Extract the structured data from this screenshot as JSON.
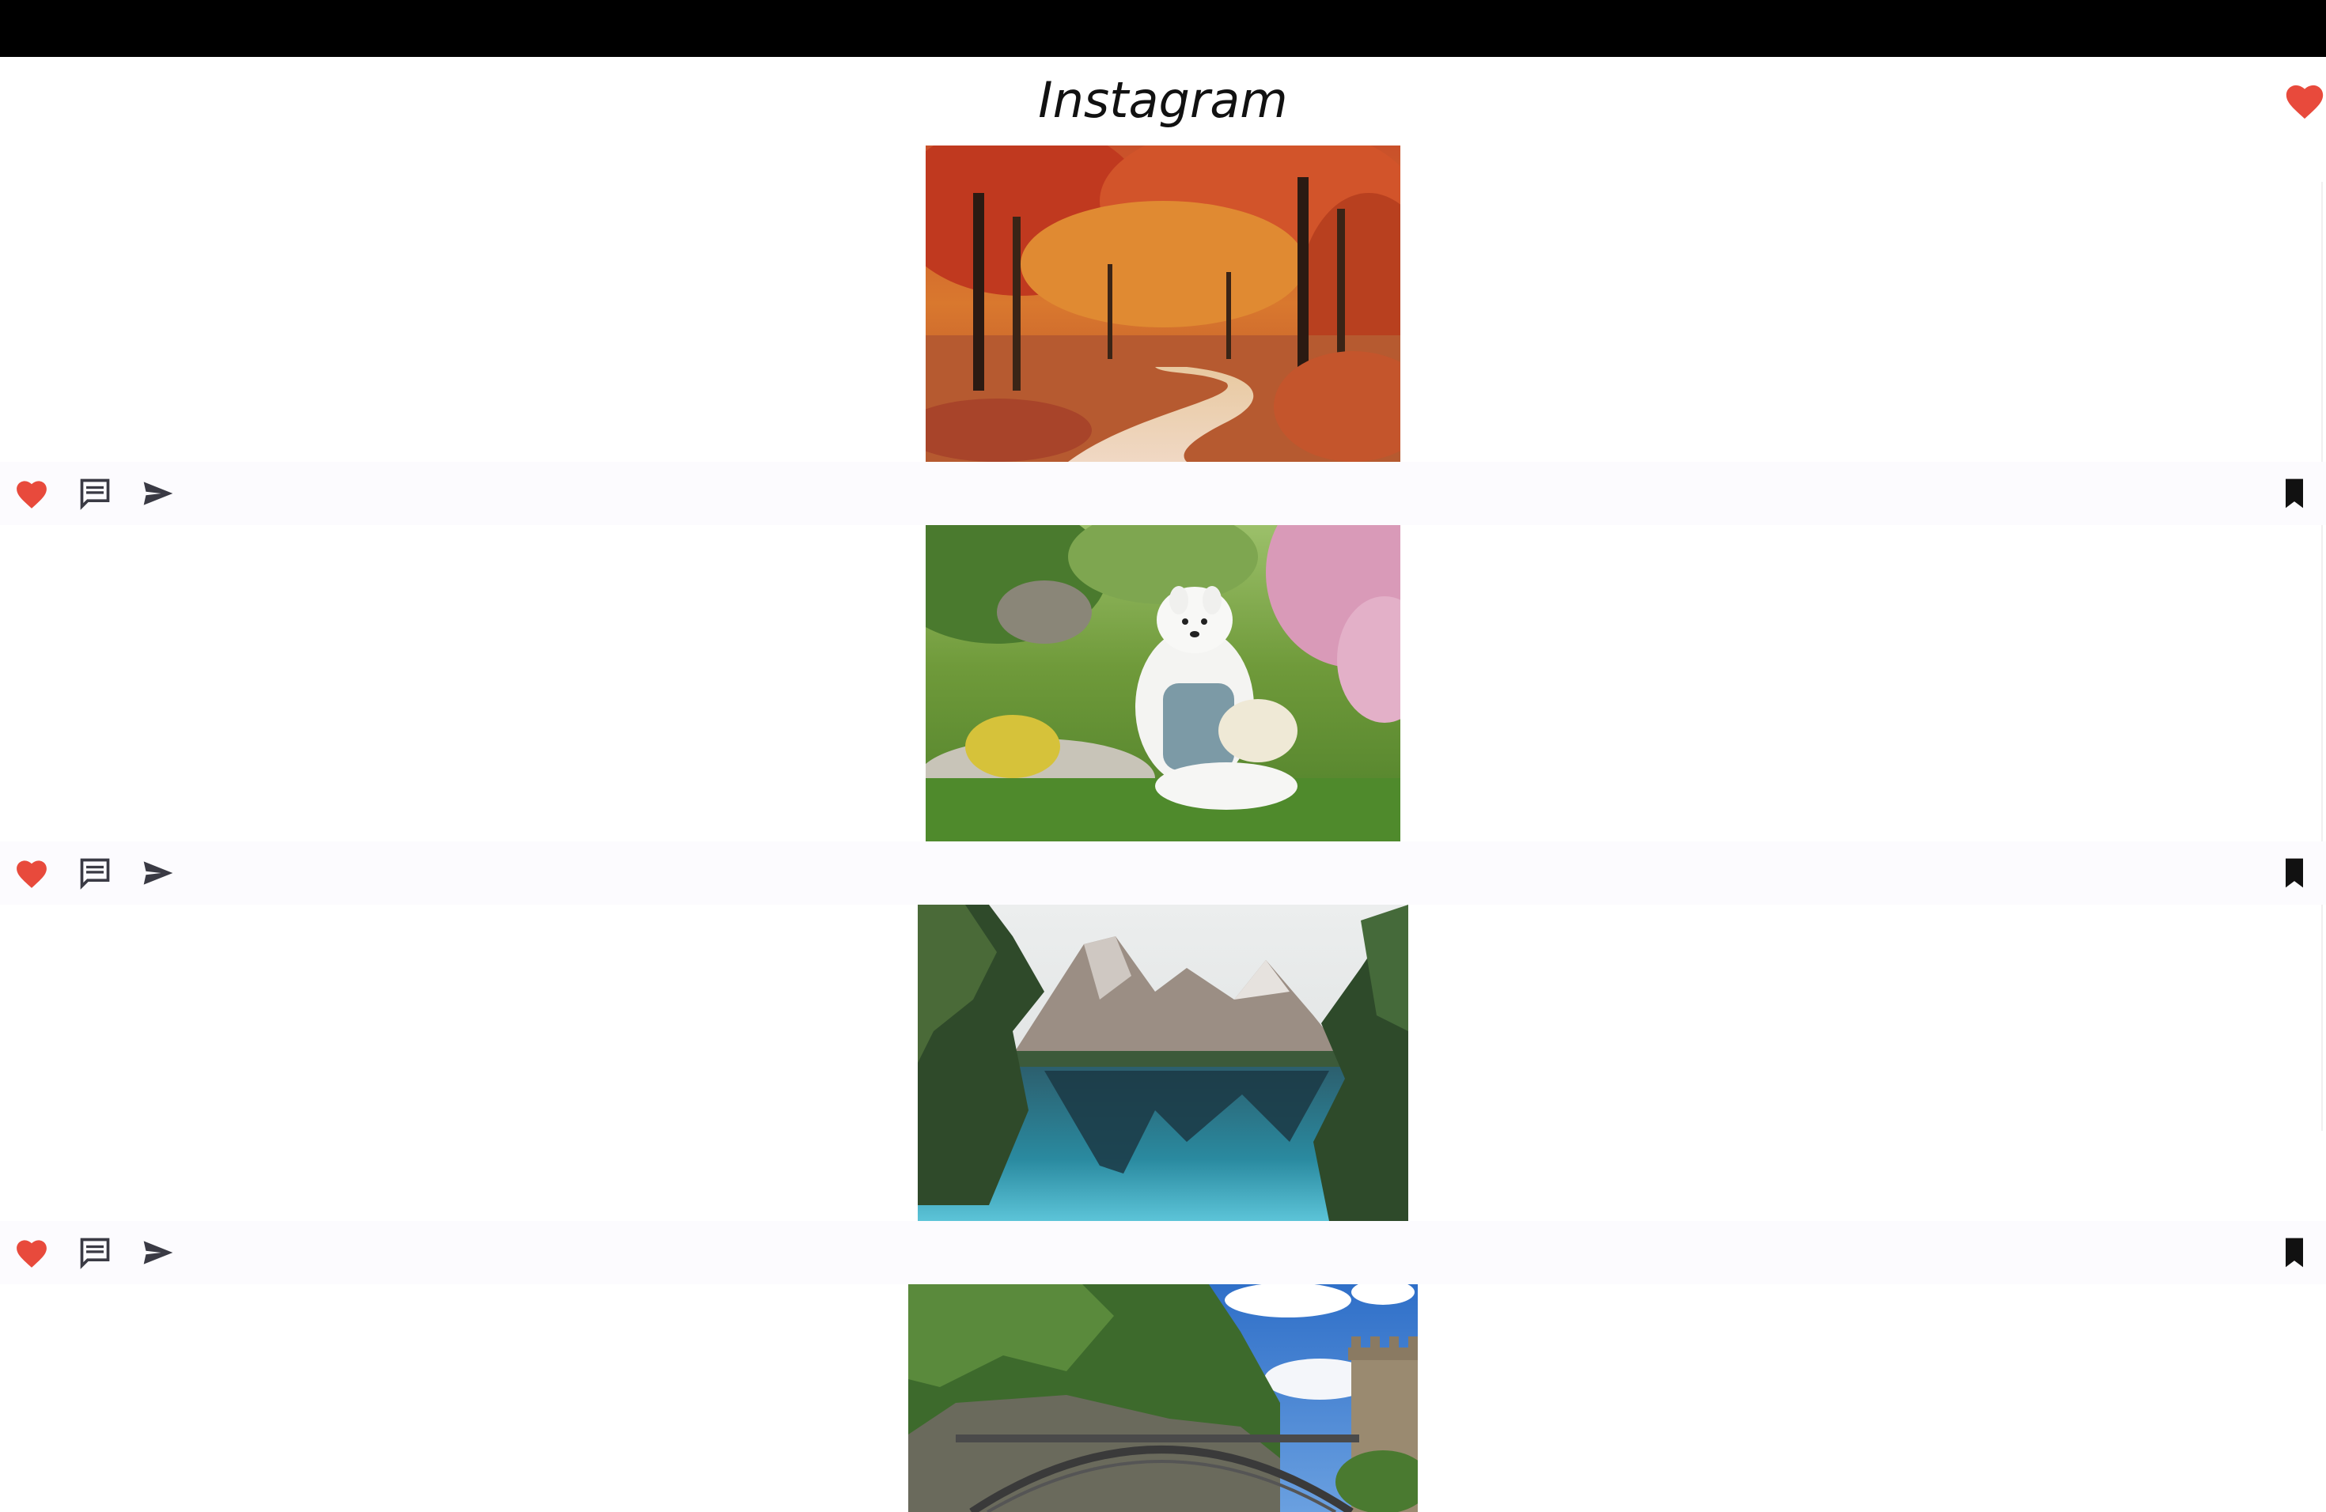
{
  "app": {
    "brand_title": "Instagram"
  },
  "header": {
    "icons": [
      "heart-icon"
    ]
  },
  "colors": {
    "heart": "#e84a3c",
    "icon_dark": "#3a3a44",
    "bookmark": "#111111",
    "topbar": "#000000",
    "action_bar": "#fcfbfe"
  },
  "posts": [
    {
      "image": "autumn-forest-path",
      "actions": [
        "heart-icon",
        "comment-icon",
        "send-icon",
        "bookmark-icon"
      ]
    },
    {
      "image": "white-dog-in-garden",
      "actions": [
        "heart-icon",
        "comment-icon",
        "send-icon",
        "bookmark-icon"
      ]
    },
    {
      "image": "mountain-lake-reflection",
      "actions": [
        "heart-icon",
        "comment-icon",
        "send-icon",
        "bookmark-icon"
      ]
    },
    {
      "image": "stone-bridge-castle-tower",
      "actions": []
    }
  ]
}
